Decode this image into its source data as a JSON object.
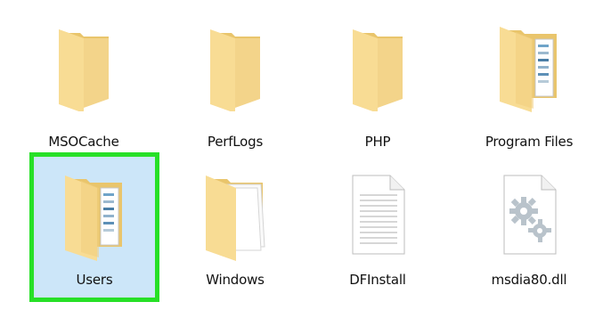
{
  "explorer": {
    "items": [
      {
        "label": "MSOCache",
        "icon": "folder-icon"
      },
      {
        "label": "PerfLogs",
        "icon": "folder-icon"
      },
      {
        "label": "PHP",
        "icon": "folder-icon"
      },
      {
        "label": "Program Files",
        "icon": "folder-with-files-icon"
      },
      {
        "label": "Users",
        "icon": "folder-with-files-icon",
        "selected": true
      },
      {
        "label": "Windows",
        "icon": "folder-with-documents-icon"
      },
      {
        "label": "DFInstall",
        "icon": "text-file-icon"
      },
      {
        "label": "msdia80.dll",
        "icon": "dll-gear-file-icon"
      }
    ]
  },
  "colors": {
    "folder_front": "#f6d88f",
    "folder_back": "#e9c56c",
    "selection_fill": "#cce6f9",
    "selection_outline": "#27e027"
  }
}
